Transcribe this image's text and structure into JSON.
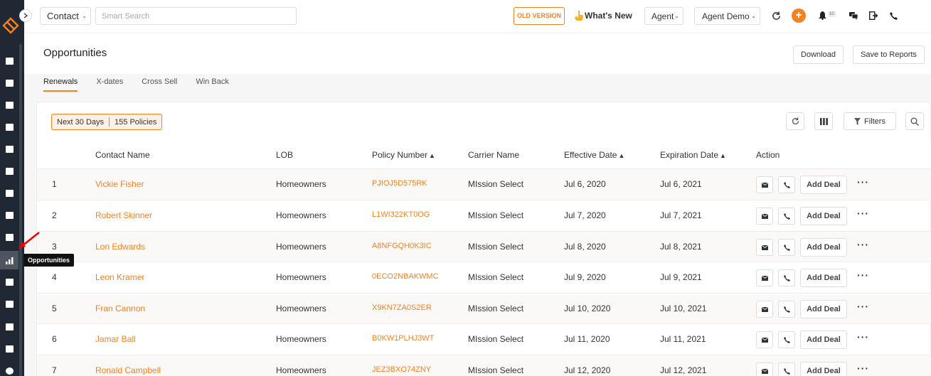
{
  "sidebar": {
    "items": [
      "dashboard-icon",
      "contacts-icon",
      "documents-icon",
      "bank-icon",
      "list-icon",
      "calculator-icon",
      "filter-funnel-icon",
      "megaphone-icon",
      "notes-icon",
      "chart-icon",
      "mail-icon",
      "report-icon",
      "calendar-icon",
      "car-icon",
      "dollar-icon"
    ],
    "tooltip": "Opportunities"
  },
  "topbar": {
    "contact_select": "Contact",
    "search_placeholder": "Smart Search",
    "old_version": "OLD VERSION",
    "whats_new": "What's New",
    "agent_select": "Agent",
    "agent_demo_select": "Agent Demo",
    "plus": "+",
    "bell_count": "10"
  },
  "page": {
    "title": "Opportunities",
    "download": "Download",
    "save_to_reports": "Save to Reports"
  },
  "tabs": [
    "Renewals",
    "X-dates",
    "Cross Sell",
    "Win Back"
  ],
  "filter_badge": {
    "range": "Next 30 Days",
    "count": "155 Policies"
  },
  "filters_label": "Filters",
  "table": {
    "headers": {
      "contact": "Contact Name",
      "lob": "LOB",
      "policy": "Policy Number",
      "carrier": "Carrier Name",
      "effective": "Effective Date",
      "expiration": "Expiration Date",
      "action": "Action"
    },
    "add_deal": "Add Deal",
    "rows": [
      {
        "n": "1",
        "contact": "Vickie Fisher",
        "lob": "Homeowners",
        "policy": "PJIOJ5D575RK",
        "carrier": "MIssion Select",
        "effective": "Jul 6, 2020",
        "expiration": "Jul 6, 2021"
      },
      {
        "n": "2",
        "contact": "Robert Skinner",
        "lob": "Homeowners",
        "policy": "L1WI322KT0OG",
        "carrier": "MIssion Select",
        "effective": "Jul 7, 2020",
        "expiration": "Jul 7, 2021"
      },
      {
        "n": "3",
        "contact": "Lon Edwards",
        "lob": "Homeowners",
        "policy": "A8NFGQH0K3IC",
        "carrier": "MIssion Select",
        "effective": "Jul 8, 2020",
        "expiration": "Jul 8, 2021"
      },
      {
        "n": "4",
        "contact": "Leon Kramer",
        "lob": "Homeowners",
        "policy": "0ECO2NBAKWMC",
        "carrier": "MIssion Select",
        "effective": "Jul 9, 2020",
        "expiration": "Jul 9, 2021"
      },
      {
        "n": "5",
        "contact": "Fran Cannon",
        "lob": "Homeowners",
        "policy": "X9KN7ZA0S2ER",
        "carrier": "MIssion Select",
        "effective": "Jul 10, 2020",
        "expiration": "Jul 10, 2021"
      },
      {
        "n": "6",
        "contact": "Jamar Ball",
        "lob": "Homeowners",
        "policy": "B0KW1PLHJ3WT",
        "carrier": "MIssion Select",
        "effective": "Jul 11, 2020",
        "expiration": "Jul 11, 2021"
      },
      {
        "n": "7",
        "contact": "Ronald Campbell",
        "lob": "Homeowners",
        "policy": "JEZ3BXO74ZNY",
        "carrier": "MIssion Select",
        "effective": "Jul 12, 2020",
        "expiration": "Jul 12, 2021"
      }
    ]
  },
  "colors": {
    "accent": "#f58220",
    "sidebar": "#1f2833"
  }
}
